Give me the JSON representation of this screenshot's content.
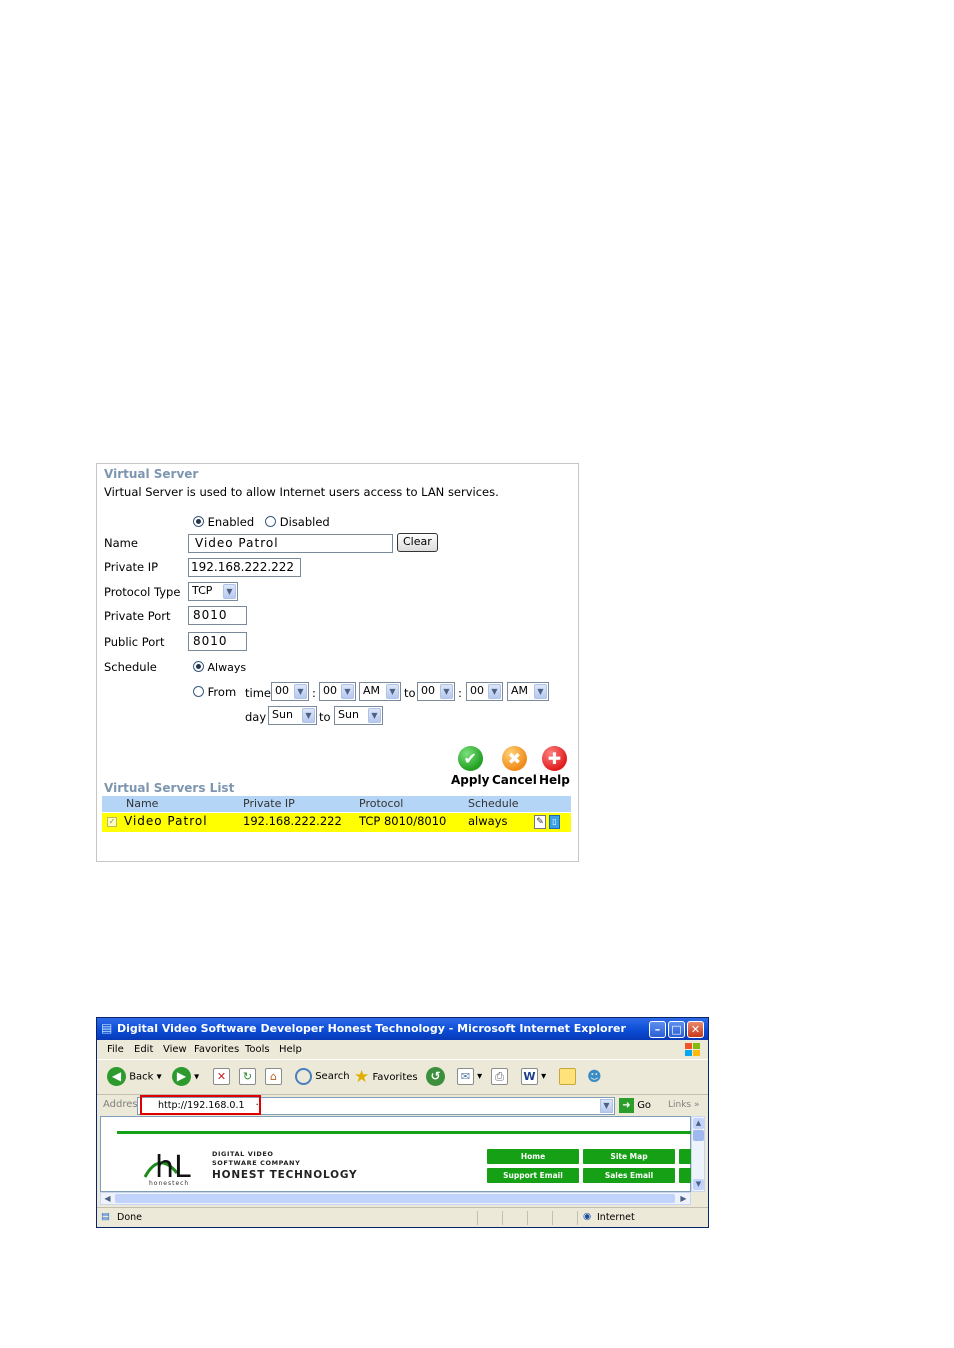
{
  "virtual_server": {
    "title": "Virtual Server",
    "description": "Virtual Server is used to allow Internet users access to LAN services.",
    "status": {
      "enabled_label": "Enabled",
      "disabled_label": "Disabled",
      "selected": "Enabled"
    },
    "fields": {
      "name_label": "Name",
      "name_value": "Video Patrol",
      "clear_label": "Clear",
      "private_ip_label": "Private IP",
      "private_ip_value": "192.168.222.222",
      "protocol_label": "Protocol Type",
      "protocol_value": "TCP",
      "private_port_label": "Private Port",
      "private_port_value": "8010",
      "public_port_label": "Public Port",
      "public_port_value": "8010"
    },
    "schedule": {
      "label": "Schedule",
      "always_label": "Always",
      "from_label": "From",
      "time_label": "time",
      "to_label": "to",
      "colon": ":",
      "day_label": "day",
      "time_from": {
        "hour": "00",
        "minute": "00",
        "ampm": "AM"
      },
      "time_to": {
        "hour": "00",
        "minute": "00",
        "ampm": "AM"
      },
      "day_from": "Sun",
      "day_to": "Sun"
    },
    "actions": {
      "apply": "Apply",
      "cancel": "Cancel",
      "help": "Help"
    },
    "list": {
      "title": "Virtual Servers List",
      "headers": {
        "name": "Name",
        "private_ip": "Private IP",
        "protocol": "Protocol",
        "schedule": "Schedule"
      },
      "rows": [
        {
          "name": "Video Patrol",
          "private_ip": "192.168.222.222",
          "protocol": "TCP 8010/8010",
          "schedule": "always"
        }
      ]
    }
  },
  "browser": {
    "title": "Digital Video Software Developer Honest Technology - Microsoft Internet Explorer",
    "menu": [
      "File",
      "Edit",
      "View",
      "Favorites",
      "Tools",
      "Help"
    ],
    "toolbar": {
      "back": "Back",
      "search": "Search",
      "favorites": "Favorites"
    },
    "address_label": "Address",
    "address_value": "http://192.168.0.1",
    "go_label": "Go",
    "links_label": "Links",
    "page": {
      "logo_text": "hL",
      "logo_small": "honestech",
      "company_line1": "DIGITAL VIDEO",
      "company_line2": "SOFTWARE COMPANY",
      "company_name": "HONEST TECHNOLOGY",
      "buttons": [
        "Home",
        "Site Map",
        "Support Email",
        "Sales Email"
      ]
    },
    "status_text": "Done",
    "zone_text": "Internet"
  },
  "colors": {
    "panel_title": "#7d96b0",
    "list_header": "#b4d5f6",
    "row_highlight": "#ffff00",
    "apply": "#22a022",
    "cancel": "#f08a18",
    "help": "#e01e1e",
    "xp_title": "#0a4bd4",
    "site_green": "#16a016",
    "address_highlight": "#e00000"
  }
}
